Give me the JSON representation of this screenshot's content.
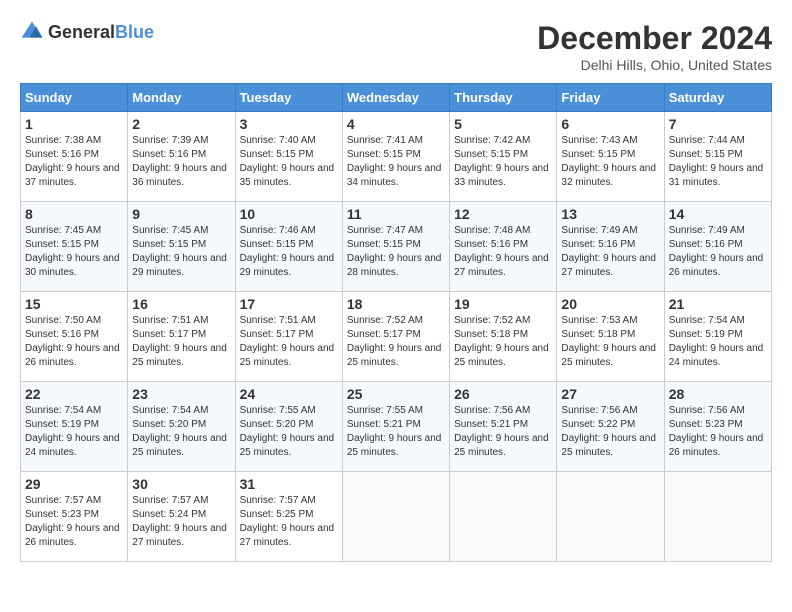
{
  "header": {
    "logo_general": "General",
    "logo_blue": "Blue",
    "month": "December 2024",
    "location": "Delhi Hills, Ohio, United States"
  },
  "days_of_week": [
    "Sunday",
    "Monday",
    "Tuesday",
    "Wednesday",
    "Thursday",
    "Friday",
    "Saturday"
  ],
  "weeks": [
    [
      {
        "day": "1",
        "sunrise": "7:38 AM",
        "sunset": "5:16 PM",
        "daylight": "9 hours and 37 minutes."
      },
      {
        "day": "2",
        "sunrise": "7:39 AM",
        "sunset": "5:16 PM",
        "daylight": "9 hours and 36 minutes."
      },
      {
        "day": "3",
        "sunrise": "7:40 AM",
        "sunset": "5:15 PM",
        "daylight": "9 hours and 35 minutes."
      },
      {
        "day": "4",
        "sunrise": "7:41 AM",
        "sunset": "5:15 PM",
        "daylight": "9 hours and 34 minutes."
      },
      {
        "day": "5",
        "sunrise": "7:42 AM",
        "sunset": "5:15 PM",
        "daylight": "9 hours and 33 minutes."
      },
      {
        "day": "6",
        "sunrise": "7:43 AM",
        "sunset": "5:15 PM",
        "daylight": "9 hours and 32 minutes."
      },
      {
        "day": "7",
        "sunrise": "7:44 AM",
        "sunset": "5:15 PM",
        "daylight": "9 hours and 31 minutes."
      }
    ],
    [
      {
        "day": "8",
        "sunrise": "7:45 AM",
        "sunset": "5:15 PM",
        "daylight": "9 hours and 30 minutes."
      },
      {
        "day": "9",
        "sunrise": "7:45 AM",
        "sunset": "5:15 PM",
        "daylight": "9 hours and 29 minutes."
      },
      {
        "day": "10",
        "sunrise": "7:46 AM",
        "sunset": "5:15 PM",
        "daylight": "9 hours and 29 minutes."
      },
      {
        "day": "11",
        "sunrise": "7:47 AM",
        "sunset": "5:15 PM",
        "daylight": "9 hours and 28 minutes."
      },
      {
        "day": "12",
        "sunrise": "7:48 AM",
        "sunset": "5:16 PM",
        "daylight": "9 hours and 27 minutes."
      },
      {
        "day": "13",
        "sunrise": "7:49 AM",
        "sunset": "5:16 PM",
        "daylight": "9 hours and 27 minutes."
      },
      {
        "day": "14",
        "sunrise": "7:49 AM",
        "sunset": "5:16 PM",
        "daylight": "9 hours and 26 minutes."
      }
    ],
    [
      {
        "day": "15",
        "sunrise": "7:50 AM",
        "sunset": "5:16 PM",
        "daylight": "9 hours and 26 minutes."
      },
      {
        "day": "16",
        "sunrise": "7:51 AM",
        "sunset": "5:17 PM",
        "daylight": "9 hours and 25 minutes."
      },
      {
        "day": "17",
        "sunrise": "7:51 AM",
        "sunset": "5:17 PM",
        "daylight": "9 hours and 25 minutes."
      },
      {
        "day": "18",
        "sunrise": "7:52 AM",
        "sunset": "5:17 PM",
        "daylight": "9 hours and 25 minutes."
      },
      {
        "day": "19",
        "sunrise": "7:52 AM",
        "sunset": "5:18 PM",
        "daylight": "9 hours and 25 minutes."
      },
      {
        "day": "20",
        "sunrise": "7:53 AM",
        "sunset": "5:18 PM",
        "daylight": "9 hours and 25 minutes."
      },
      {
        "day": "21",
        "sunrise": "7:54 AM",
        "sunset": "5:19 PM",
        "daylight": "9 hours and 24 minutes."
      }
    ],
    [
      {
        "day": "22",
        "sunrise": "7:54 AM",
        "sunset": "5:19 PM",
        "daylight": "9 hours and 24 minutes."
      },
      {
        "day": "23",
        "sunrise": "7:54 AM",
        "sunset": "5:20 PM",
        "daylight": "9 hours and 25 minutes."
      },
      {
        "day": "24",
        "sunrise": "7:55 AM",
        "sunset": "5:20 PM",
        "daylight": "9 hours and 25 minutes."
      },
      {
        "day": "25",
        "sunrise": "7:55 AM",
        "sunset": "5:21 PM",
        "daylight": "9 hours and 25 minutes."
      },
      {
        "day": "26",
        "sunrise": "7:56 AM",
        "sunset": "5:21 PM",
        "daylight": "9 hours and 25 minutes."
      },
      {
        "day": "27",
        "sunrise": "7:56 AM",
        "sunset": "5:22 PM",
        "daylight": "9 hours and 25 minutes."
      },
      {
        "day": "28",
        "sunrise": "7:56 AM",
        "sunset": "5:23 PM",
        "daylight": "9 hours and 26 minutes."
      }
    ],
    [
      {
        "day": "29",
        "sunrise": "7:57 AM",
        "sunset": "5:23 PM",
        "daylight": "9 hours and 26 minutes."
      },
      {
        "day": "30",
        "sunrise": "7:57 AM",
        "sunset": "5:24 PM",
        "daylight": "9 hours and 27 minutes."
      },
      {
        "day": "31",
        "sunrise": "7:57 AM",
        "sunset": "5:25 PM",
        "daylight": "9 hours and 27 minutes."
      },
      null,
      null,
      null,
      null
    ]
  ],
  "labels": {
    "sunrise": "Sunrise:",
    "sunset": "Sunset:",
    "daylight": "Daylight:"
  }
}
